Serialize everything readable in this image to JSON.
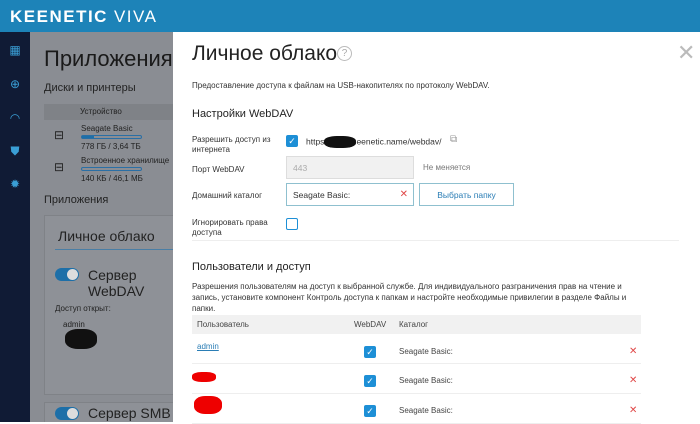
{
  "header": {
    "brand": "KEENETIC",
    "model": "VIVA"
  },
  "sidebar": {
    "icons": [
      "dashboard-icon",
      "globe-icon",
      "wifi-icon",
      "shield-icon",
      "gear-icon"
    ]
  },
  "background": {
    "title": "Приложения",
    "disks_heading": "Диски и принтеры",
    "device_col": "Устройство",
    "disks": [
      {
        "name": "Seagate Basic",
        "usage": "778 ГБ / 3,64 ТБ",
        "fill": 0.21
      },
      {
        "name": "Встроенное хранилище",
        "usage": "140 КБ / 46,1 МБ",
        "fill": 0.0
      }
    ],
    "apps_heading": "Приложения",
    "card_title": "Личное облако",
    "webdav_toggle": "Сервер WebDAV",
    "access_open": "Доступ открыт:",
    "access_user": "admin",
    "smb_toggle": "Сервер SMB"
  },
  "modal": {
    "title": "Личное облако",
    "help": "?",
    "close": "✕",
    "description": "Предоставление доступа к файлам на USB-накопителях по протоколу WebDAV.",
    "settings_heading": "Настройки WebDAV",
    "allow_label": "Разрешить доступ из интернета",
    "allow_checked": true,
    "url_prefix": "https",
    "url_suffix": "eenetic.name/webdav/",
    "port_label": "Порт WebDAV",
    "port_value": "443",
    "port_note": "Не меняется",
    "home_label": "Домашний каталог",
    "home_value": "Seagate Basic:",
    "choose_folder": "Выбрать папку",
    "ignore_label": "Игнорировать права доступа",
    "ignore_checked": false,
    "users_heading": "Пользователи и доступ",
    "users_desc": "Разрешения пользователям на доступ к выбранной службе. Для индивидуального разграничения прав на чтение и запись, установите компонент Контроль доступа к папкам и настройте необходимые привилегии в разделе Файлы и папки.",
    "table": {
      "headers": [
        "Пользователь",
        "WebDAV",
        "Каталог"
      ],
      "rows": [
        {
          "user": "admin",
          "webdav": true,
          "catalog": "Seagate Basic:"
        },
        {
          "user": "",
          "webdav": true,
          "catalog": "Seagate Basic:"
        },
        {
          "user": "",
          "webdav": true,
          "catalog": "Seagate Basic:"
        }
      ]
    }
  }
}
